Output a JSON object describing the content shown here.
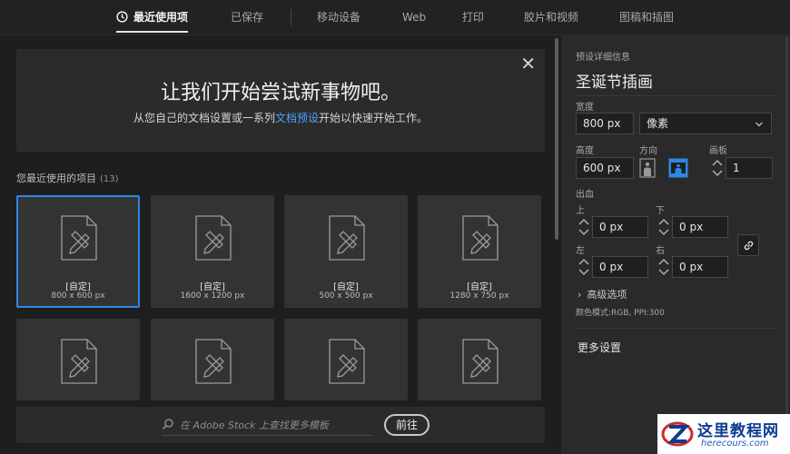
{
  "tabs": [
    {
      "label": "最近使用项",
      "active": true
    },
    {
      "label": "已保存"
    },
    {
      "label": "移动设备"
    },
    {
      "label": "Web"
    },
    {
      "label": "打印"
    },
    {
      "label": "胶片和视频"
    },
    {
      "label": "图稿和插图"
    }
  ],
  "hero": {
    "title": "让我们开始尝试新事物吧。",
    "sub_before": "从您自己的文档设置或一系列",
    "sub_link": "文档预设",
    "sub_after": "开始以快速开始工作。",
    "close": "✕"
  },
  "recent": {
    "label": "您最近使用的项目",
    "count": "(13)",
    "items": [
      {
        "name": "[自定]",
        "size": "800 x 600 px",
        "selected": true
      },
      {
        "name": "[自定]",
        "size": "1600 x 1200 px"
      },
      {
        "name": "[自定]",
        "size": "500 x 500 px"
      },
      {
        "name": "[自定]",
        "size": "1280 x 750 px"
      },
      {
        "name": "",
        "size": ""
      },
      {
        "name": "",
        "size": ""
      },
      {
        "name": "",
        "size": ""
      },
      {
        "name": "",
        "size": ""
      }
    ]
  },
  "stock": {
    "placeholder": "在 Adobe Stock 上查找更多模板",
    "button": "前往"
  },
  "panel": {
    "section_title": "预设详细信息",
    "preset_name": "圣诞节插画",
    "width_label": "宽度",
    "width_value": "800 px",
    "unit_value": "像素",
    "height_label": "高度",
    "height_value": "600 px",
    "orientation_label": "方向",
    "artboards_label": "画板",
    "artboards_value": "1",
    "bleed_label": "出血",
    "top_label": "上",
    "top_value": "0 px",
    "bottom_label": "下",
    "bottom_value": "0 px",
    "left_label": "左",
    "left_value": "0 px",
    "right_label": "右",
    "right_value": "0 px",
    "advanced": "高级选项",
    "color_mode": "颜色模式:RGB, PPI:300",
    "more_settings": "更多设置"
  },
  "watermark": {
    "cn": "这里教程网",
    "en": "herecours.com"
  },
  "colors": {
    "accent": "#2d87e6",
    "link": "#4aa3ff",
    "background": "#1e1e1e",
    "panel": "#2a2a2a"
  }
}
